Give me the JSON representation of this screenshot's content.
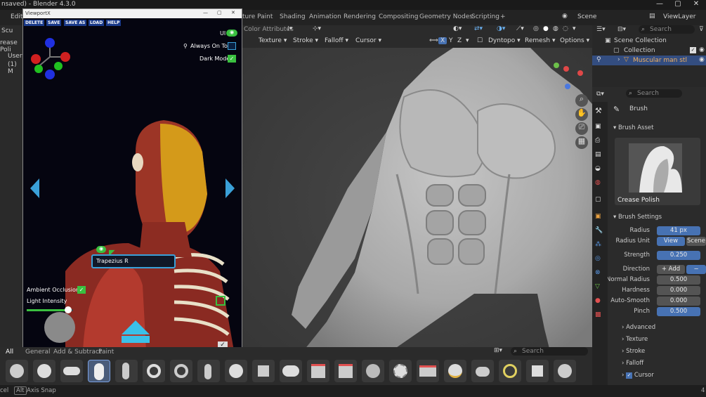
{
  "titlebar": {
    "title": "nsaved) - Blender 4.3.0"
  },
  "menu": {
    "items": [
      "Edit",
      "ture Paint",
      "Shading",
      "Animation",
      "Rendering",
      "Compositing",
      "Geometry Nodes",
      "Scripting",
      "+"
    ],
    "scene": "Scene",
    "view_layer": "ViewLayer",
    "sculpt": "Scu",
    "edit": "Edit"
  },
  "left": {
    "mode_label": "rease Poli",
    "user": "User",
    "collection_line": "(1) M"
  },
  "viewport_header": {
    "color_attributes": "Color Attributes",
    "texture": "Texture",
    "stroke": "Stroke",
    "falloff": "Falloff",
    "cursor": "Cursor",
    "dyntopo": "Dyntopo",
    "remesh": "Remesh",
    "options": "Options",
    "axis_x": "X",
    "axis_y": "Y",
    "axis_z": "Z"
  },
  "viewportx": {
    "title": "ViewportX",
    "buttons": [
      "DELETE",
      "SAVE",
      "SAVE AS",
      "LOAD",
      "HELP"
    ],
    "ui_label": "UI",
    "always_on_top": "Always On Top",
    "dark_mode": "Dark Mode",
    "muscle_label": "Trapezius R",
    "ambient_occlusion": "Ambient Occlusion",
    "light_intensity": "Light Intensity",
    "light_value": 0.9
  },
  "outliner": {
    "search_placeholder": "Search",
    "scene_collection": "Scene Collection",
    "collection": "Collection",
    "object": "Muscular man stl"
  },
  "properties": {
    "search_placeholder": "Search",
    "brush_label": "Brush",
    "brush_asset": "Brush Asset",
    "brush_name": "Crease Polish",
    "brush_settings": "Brush Settings",
    "radius_label": "Radius",
    "radius_value": "41 px",
    "radius_unit_label": "Radius Unit",
    "radius_unit_view": "View",
    "radius_unit_scene": "Scene",
    "strength_label": "Strength",
    "strength_value": "0.250",
    "direction_label": "Direction",
    "direction_add": "+ Add",
    "direction_sub": "− Subt",
    "normal_radius_label": "Normal Radius",
    "normal_radius_value": "0.500",
    "hardness_label": "Hardness",
    "hardness_value": "0.000",
    "auto_smooth_label": "Auto-Smooth",
    "auto_smooth_value": "0.000",
    "pinch_label": "Pinch",
    "pinch_value": "0.500",
    "advanced": "Advanced",
    "texture": "Texture",
    "stroke": "Stroke",
    "falloff": "Falloff",
    "cursor": "Cursor"
  },
  "brush_tabs": {
    "all": "All",
    "general": "General",
    "add_subtract": "Add & Subtract",
    "paint": "Paint",
    "search_placeholder": "Search"
  },
  "status": {
    "cancel": "cel",
    "alt": "Alt",
    "axis_snap": "Axis Snap",
    "version": "4"
  }
}
